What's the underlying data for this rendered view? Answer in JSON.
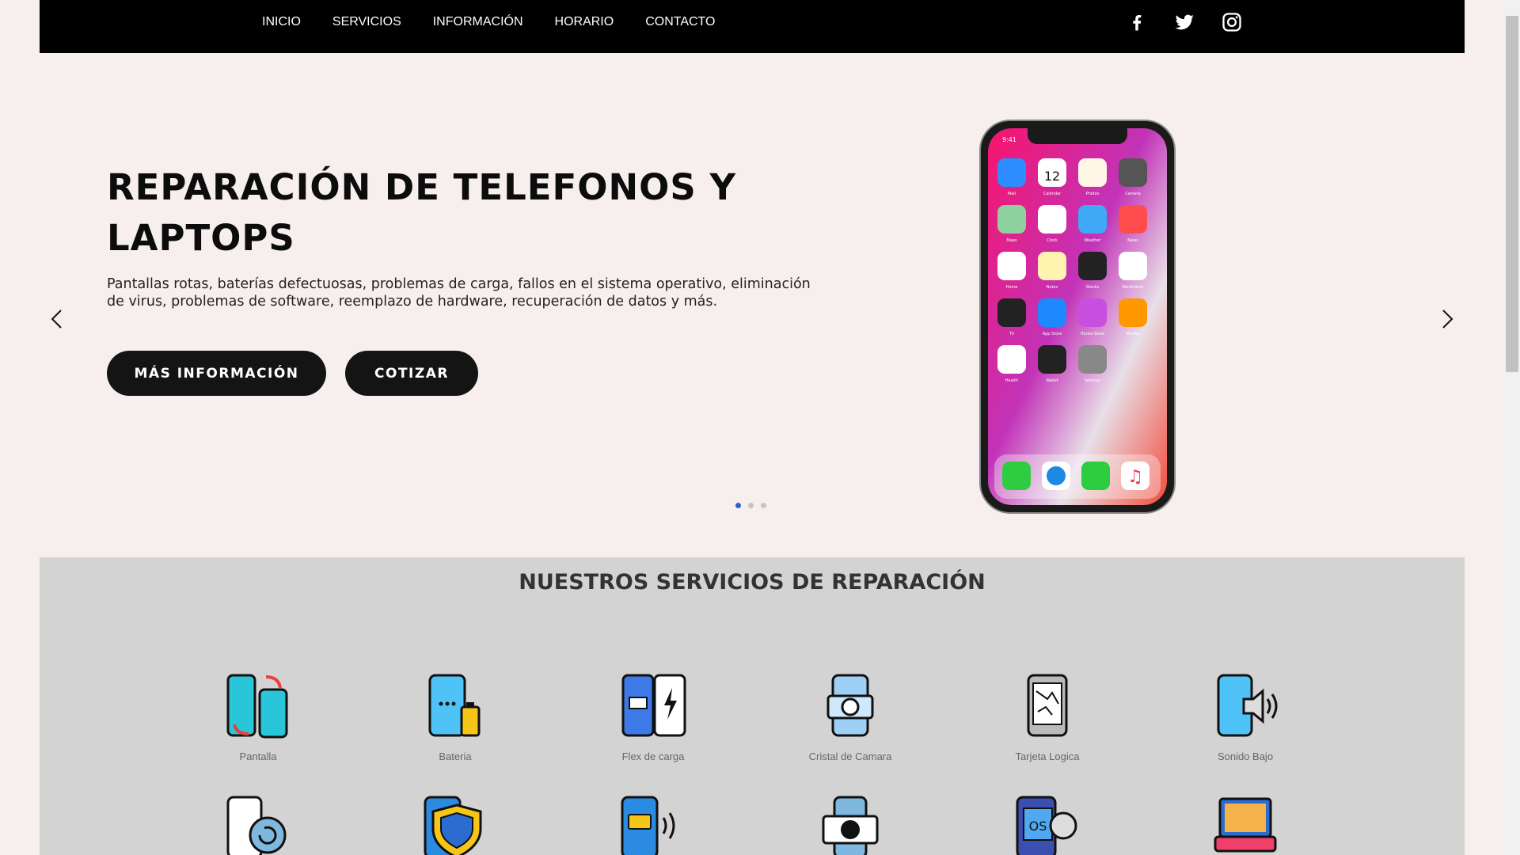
{
  "nav": {
    "links": [
      "INICIO",
      "SERVICIOS",
      "INFORMACIÓN",
      "HORARIO",
      "CONTACTO"
    ],
    "social": [
      "facebook-icon",
      "twitter-icon",
      "instagram-icon"
    ]
  },
  "hero": {
    "title": "REPARACIÓN DE TELEFONOS Y LAPTOPS",
    "description": "Pantallas rotas, baterías defectuosas, problemas de carga, fallos en el sistema operativo, eliminación de virus, problemas de software, reemplazo de hardware, recuperación de datos y más.",
    "btn_info": "MÁS INFORMACIÓN",
    "btn_quote": "COTIZAR",
    "slides": 3,
    "active_slide": 1
  },
  "phone": {
    "time": "9:41",
    "date_num": "12",
    "apps": [
      "Mail",
      "Calendar",
      "Photos",
      "Camera",
      "Maps",
      "Clock",
      "Weather",
      "News",
      "Home",
      "Notes",
      "Stocks",
      "Reminders",
      "TV",
      "App Store",
      "iTunes Store",
      "iBooks",
      "Health",
      "Wallet",
      "Settings"
    ]
  },
  "services": {
    "title": "NUESTROS SERVICIOS DE REPARACIÓN",
    "items": [
      "Pantalla",
      "Bateria",
      "Flex de carga",
      "Cristal de Camara",
      "Tarjeta Logica",
      "Sonido Bajo"
    ]
  },
  "colors": {
    "background": "#f7efee",
    "nav": "#000000",
    "services_bg": "#d3d3d3",
    "button": "#141414",
    "dot_active": "#2f5fd0"
  }
}
